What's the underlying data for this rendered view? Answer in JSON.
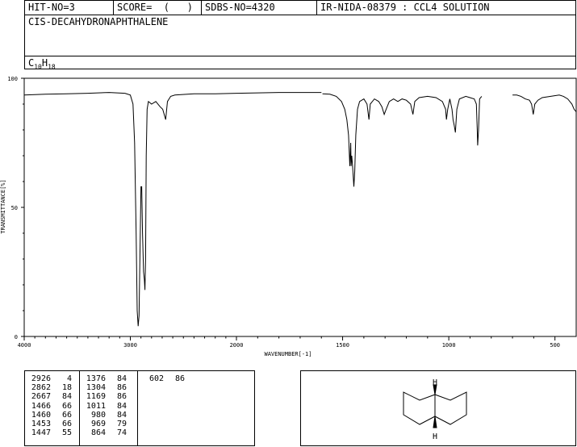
{
  "header": {
    "hit_no": "HIT-NO=3",
    "score": "SCORE=  (   )",
    "sdbs_no": "SDBS-NO=4320",
    "ir_info": "IR-NIDA-08379 : CCL4 SOLUTION",
    "compound_name": "CIS-DECAHYDRONAPHTHALENE",
    "formula_c": "C",
    "formula_c_sub": "10",
    "formula_h": "H",
    "formula_h_sub": "18"
  },
  "chart_data": {
    "type": "line",
    "xlabel": "WAVENUMBER[-1]",
    "ylabel": "TRANSMITTANCE[%]",
    "xlim": [
      4000,
      400
    ],
    "ylim": [
      0,
      100
    ],
    "x_ticks": [
      4000,
      3000,
      2000,
      1500,
      1000,
      500
    ],
    "y_ticks": [
      0,
      50,
      100
    ],
    "segments": [
      [
        [
          4000,
          93.5
        ],
        [
          3800,
          93.8
        ],
        [
          3600,
          94
        ],
        [
          3400,
          94.2
        ],
        [
          3200,
          94.5
        ],
        [
          3050,
          94.2
        ],
        [
          3000,
          93.5
        ],
        [
          2975,
          90
        ],
        [
          2960,
          75
        ],
        [
          2945,
          40
        ],
        [
          2935,
          10
        ],
        [
          2926,
          4
        ],
        [
          2918,
          8
        ],
        [
          2908,
          35
        ],
        [
          2900,
          58
        ],
        [
          2893,
          58
        ],
        [
          2885,
          40
        ],
        [
          2875,
          25
        ],
        [
          2868,
          22
        ],
        [
          2862,
          18
        ],
        [
          2856,
          30
        ],
        [
          2850,
          70
        ],
        [
          2842,
          88
        ],
        [
          2830,
          91
        ],
        [
          2800,
          90
        ],
        [
          2760,
          91
        ],
        [
          2720,
          89
        ],
        [
          2695,
          88
        ],
        [
          2667,
          84
        ],
        [
          2650,
          91
        ],
        [
          2620,
          93
        ],
        [
          2580,
          93.5
        ],
        [
          2400,
          94
        ],
        [
          2200,
          94
        ],
        [
          2000,
          94.2
        ],
        [
          1800,
          94.5
        ],
        [
          1600,
          94.5
        ]
      ],
      [
        [
          1595,
          94
        ],
        [
          1560,
          93.8
        ],
        [
          1530,
          93
        ],
        [
          1505,
          91
        ],
        [
          1490,
          88
        ],
        [
          1480,
          84
        ],
        [
          1472,
          78
        ],
        [
          1466,
          66
        ],
        [
          1462,
          75
        ],
        [
          1460,
          66
        ],
        [
          1457,
          70
        ],
        [
          1453,
          66
        ],
        [
          1450,
          62
        ],
        [
          1447,
          58
        ],
        [
          1443,
          64
        ],
        [
          1438,
          78
        ],
        [
          1430,
          88
        ],
        [
          1420,
          91
        ],
        [
          1400,
          92
        ],
        [
          1385,
          90
        ],
        [
          1376,
          84
        ],
        [
          1370,
          90
        ],
        [
          1350,
          92
        ],
        [
          1330,
          91
        ],
        [
          1315,
          89
        ],
        [
          1304,
          86
        ],
        [
          1295,
          88
        ],
        [
          1280,
          91
        ],
        [
          1260,
          92
        ],
        [
          1240,
          91
        ],
        [
          1220,
          92
        ],
        [
          1200,
          91.5
        ],
        [
          1180,
          90
        ],
        [
          1169,
          86
        ],
        [
          1160,
          91
        ],
        [
          1140,
          92.5
        ],
        [
          1100,
          93
        ],
        [
          1060,
          92.5
        ],
        [
          1030,
          91
        ],
        [
          1015,
          88
        ],
        [
          1011,
          84
        ],
        [
          1005,
          88
        ],
        [
          995,
          92
        ],
        [
          985,
          88
        ],
        [
          980,
          84
        ],
        [
          975,
          82
        ],
        [
          969,
          79
        ],
        [
          962,
          88
        ],
        [
          950,
          92
        ],
        [
          920,
          93
        ],
        [
          900,
          92.5
        ],
        [
          880,
          92
        ],
        [
          870,
          90
        ],
        [
          866,
          80
        ],
        [
          864,
          74
        ],
        [
          860,
          80
        ],
        [
          855,
          92
        ],
        [
          845,
          93
        ]
      ],
      [
        [
          700,
          93.5
        ],
        [
          680,
          93.5
        ],
        [
          660,
          93
        ],
        [
          640,
          92
        ],
        [
          620,
          91.5
        ],
        [
          610,
          90
        ],
        [
          602,
          86
        ],
        [
          595,
          90
        ],
        [
          580,
          91.5
        ],
        [
          560,
          92.5
        ],
        [
          520,
          93
        ],
        [
          480,
          93.5
        ],
        [
          460,
          93
        ],
        [
          440,
          92
        ],
        [
          420,
          90
        ],
        [
          410,
          88
        ],
        [
          400,
          87
        ]
      ]
    ]
  },
  "peaks": [
    [
      [
        "2926",
        "4"
      ],
      [
        "2862",
        "18"
      ],
      [
        "2667",
        "84"
      ],
      [
        "1466",
        "66"
      ],
      [
        "1460",
        "66"
      ],
      [
        "1453",
        "66"
      ],
      [
        "1447",
        "55"
      ]
    ],
    [
      [
        "1376",
        "84"
      ],
      [
        "1304",
        "86"
      ],
      [
        "1169",
        "86"
      ],
      [
        "1011",
        "84"
      ],
      [
        "980",
        "84"
      ],
      [
        "969",
        "79"
      ],
      [
        "864",
        "74"
      ]
    ],
    [
      [
        "602",
        "86"
      ]
    ]
  ],
  "structure": {
    "top_label": "H",
    "bottom_label": "H"
  }
}
